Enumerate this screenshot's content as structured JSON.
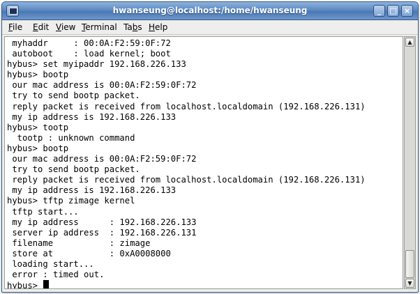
{
  "window": {
    "title": "hwanseung@localhost:/home/hwanseung",
    "buttons": {
      "minimize": "_",
      "maximize": "□",
      "close": "×"
    }
  },
  "menu": [
    {
      "pre": "",
      "u": "F",
      "post": "ile"
    },
    {
      "pre": "",
      "u": "E",
      "post": "dit"
    },
    {
      "pre": "",
      "u": "V",
      "post": "iew"
    },
    {
      "pre": "",
      "u": "T",
      "post": "erminal"
    },
    {
      "pre": "Ta",
      "u": "b",
      "post": "s"
    },
    {
      "pre": "",
      "u": "H",
      "post": "elp"
    }
  ],
  "terminal": {
    "lines": [
      " myhaddr     : 00:0A:F2:59:0F:72",
      " autoboot    : load kernel; boot",
      "hybus> set myipaddr 192.168.226.133",
      "hybus> bootp",
      " our mac address is 00:0A:F2:59:0F:72",
      " try to send bootp packet.",
      " reply packet is received from localhost.localdomain (192.168.226.131)",
      " my ip address is 192.168.226.133",
      "hybus> tootp",
      "  tootp : unknown command",
      "hybus> bootp",
      " our mac address is 00:0A:F2:59:0F:72",
      " try to send bootp packet.",
      " reply packet is received from localhost.localdomain (192.168.226.131)",
      " my ip address is 192.168.226.133",
      "hybus> tftp zimage kernel",
      " tftp start...",
      " my ip address      : 192.168.226.133",
      " server ip address  : 192.168.226.131",
      " filename           : zimage",
      " store at           : 0xA0008000",
      " loading start...",
      " error : timed out.",
      "hybus> "
    ],
    "scroll_position": 1.0,
    "visible_fraction": 0.12
  },
  "colors": {
    "titlebar": "#5d8ac2",
    "terminal_bg": "#ffffff",
    "terminal_fg": "#000000"
  }
}
